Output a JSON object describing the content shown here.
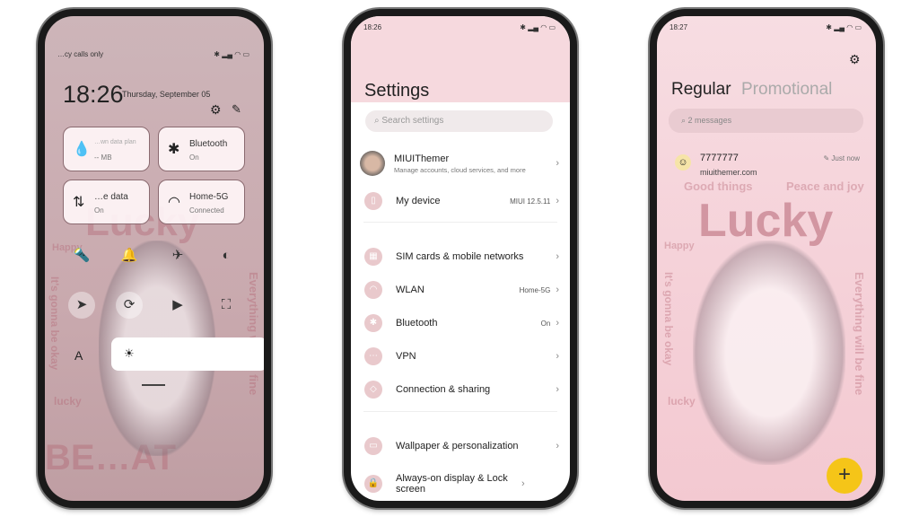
{
  "phone1": {
    "status_left": "…cy calls only",
    "time": "18:26",
    "date": "Thursday, September 05",
    "tiles": [
      {
        "title": "…wn data plan",
        "sub": "-- MB",
        "icon": "water-drop-icon"
      },
      {
        "title": "Bluetooth",
        "sub": "On",
        "icon": "bluetooth-icon"
      },
      {
        "title": "…e data",
        "sub": "On",
        "icon": "mobile-data-icon"
      },
      {
        "title": "Home-5G",
        "sub": "Connected",
        "icon": "wifi-icon"
      }
    ],
    "brightness_label": "A",
    "wallpaper_text": [
      "Lucky",
      "Happy",
      "It's gonna be okay",
      "Everything will be fine",
      "lucky",
      "BE…AT"
    ]
  },
  "phone2": {
    "status_time": "18:26",
    "title": "Settings",
    "search_placeholder": "Search settings",
    "account": {
      "name": "MIUIThemer",
      "sub": "Manage accounts, cloud services, and more"
    },
    "items": [
      {
        "label": "My device",
        "value": "MIUI 12.5.11"
      },
      {
        "label": "SIM cards & mobile networks",
        "value": ""
      },
      {
        "label": "WLAN",
        "value": "Home-5G"
      },
      {
        "label": "Bluetooth",
        "value": "On"
      },
      {
        "label": "VPN",
        "value": ""
      },
      {
        "label": "Connection & sharing",
        "value": ""
      },
      {
        "label": "Wallpaper & personalization",
        "value": ""
      },
      {
        "label": "Always-on display & Lock screen",
        "value": ""
      }
    ]
  },
  "phone3": {
    "status_time": "18:27",
    "tab_regular": "Regular",
    "tab_promotional": "Promotional",
    "search_placeholder": "2 messages",
    "message": {
      "sender": "7777777",
      "preview": "miuithemer.com",
      "time": "Just now"
    },
    "fab": "+",
    "fab_color": "#f5c518",
    "wallpaper_text": [
      "Good things",
      "Peace and joy",
      "Lucky",
      "Happy",
      "It's gonna be okay",
      "Everything will be fine",
      "lucky"
    ]
  }
}
